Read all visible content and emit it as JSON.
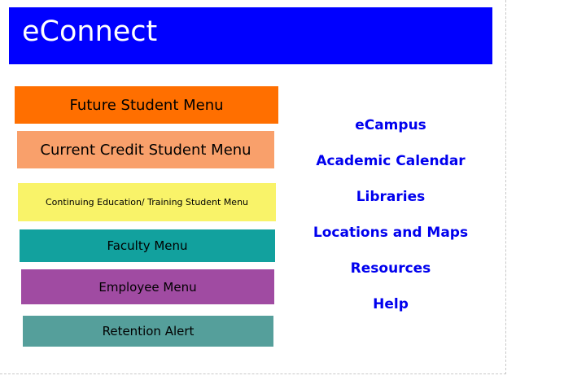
{
  "header": {
    "title": "eConnect",
    "color": "#0000ff"
  },
  "menus": {
    "future": {
      "label": "Future Student Menu",
      "color": "#ff6f00"
    },
    "current": {
      "label": "Current Credit Student Menu",
      "color": "#f9a06b"
    },
    "continuing": {
      "label": "Continuing Education/ Training Student Menu",
      "color": "#f9f369"
    },
    "faculty": {
      "label": "Faculty Menu",
      "color": "#12a19e"
    },
    "employee": {
      "label": "Employee Menu",
      "color": "#a04ba2"
    },
    "retention": {
      "label": "Retention Alert",
      "color": "#559f9b"
    }
  },
  "links": {
    "ecampus": "eCampus",
    "calendar": "Academic Calendar",
    "libraries": "Libraries",
    "locations": "Locations and Maps",
    "resources": "Resources",
    "help": "Help",
    "color": "#0000ee"
  }
}
